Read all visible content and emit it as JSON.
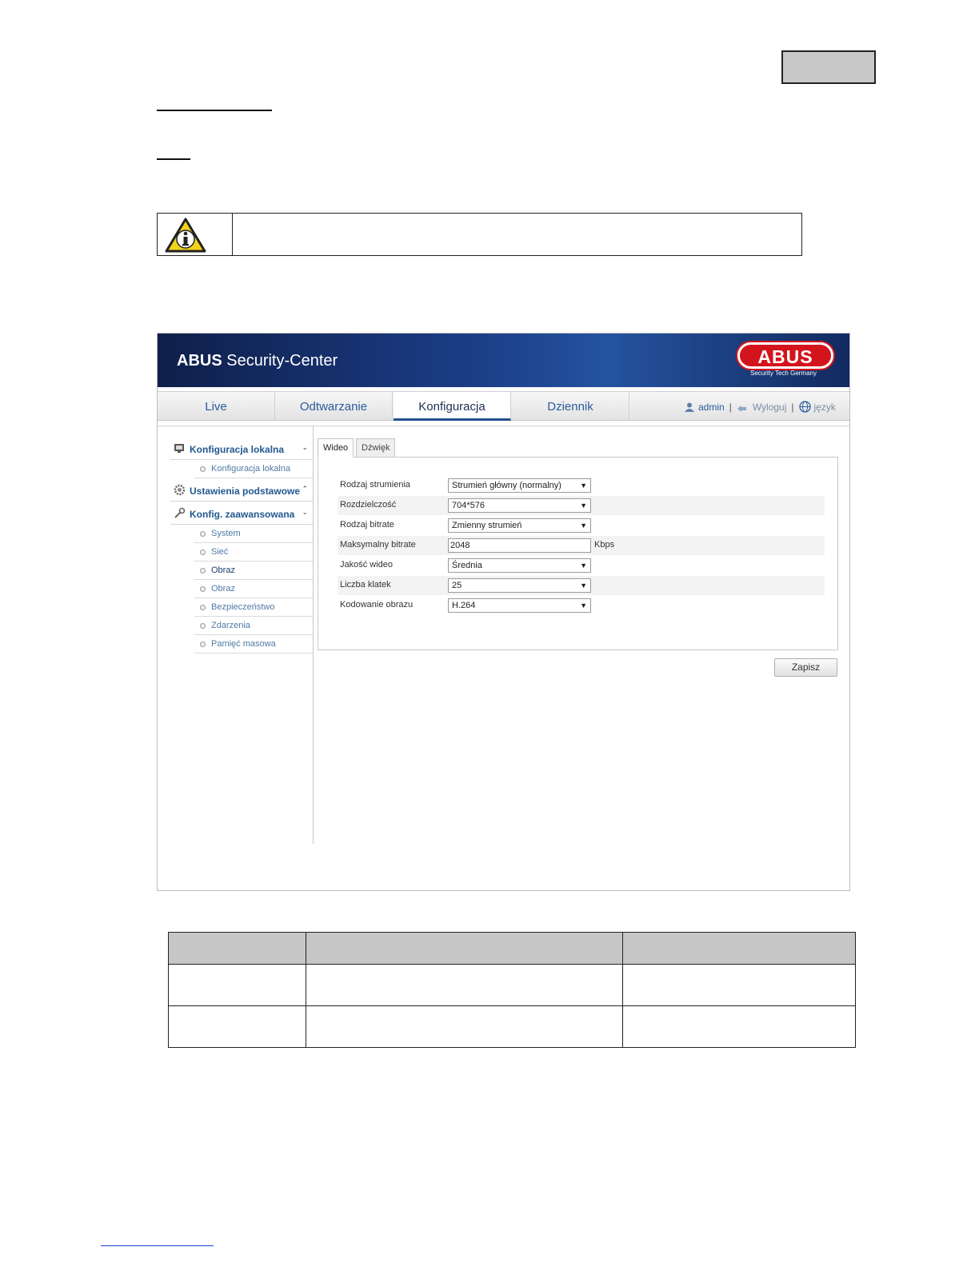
{
  "app": {
    "title_bold": "ABUS",
    "title_rest": " Security-Center",
    "logo_text": "ABUS",
    "logo_tagline": "Security Tech Germany"
  },
  "nav": {
    "tabs": [
      "Live",
      "Odtwarzanie",
      "Konfiguracja",
      "Dziennik"
    ],
    "active_tab": "Konfiguracja",
    "user": "admin",
    "logout": "Wyloguj",
    "language": "język"
  },
  "sidebar": {
    "local_section": "Konfiguracja lokalna",
    "local_items": [
      "Konfiguracja lokalna"
    ],
    "basic_section": "Ustawienia podstawowe",
    "advanced_section": "Konfig. zaawansowana",
    "advanced_items": [
      "System",
      "Sieć",
      "Obraz",
      "Obraz",
      "Bezpieczeństwo",
      "Zdarzenia",
      "Pamięć masowa"
    ],
    "current_item": "Obraz"
  },
  "panel": {
    "tabs": [
      "Wideo",
      "Dźwięk"
    ],
    "active_tab": "Wideo",
    "fields": [
      {
        "label": "Rodzaj strumienia",
        "type": "select",
        "value": "Strumień główny (normalny)"
      },
      {
        "label": "Rozdzielczość",
        "type": "select",
        "value": "704*576"
      },
      {
        "label": "Rodzaj bitrate",
        "type": "select",
        "value": "Zmienny strumień"
      },
      {
        "label": "Maksymalny bitrate",
        "type": "input",
        "value": "2048",
        "unit": "Kbps"
      },
      {
        "label": "Jakość wideo",
        "type": "select",
        "value": "Średnia"
      },
      {
        "label": "Liczba klatek",
        "type": "select",
        "value": "25"
      },
      {
        "label": "Kodowanie obrazu",
        "type": "select",
        "value": "H.264"
      }
    ],
    "save_label": "Zapisz"
  },
  "colors": {
    "banner": "#1b3d86",
    "link": "#2a5c9a",
    "logo_red": "#d4141c",
    "table_header": "#c6c6c6"
  }
}
